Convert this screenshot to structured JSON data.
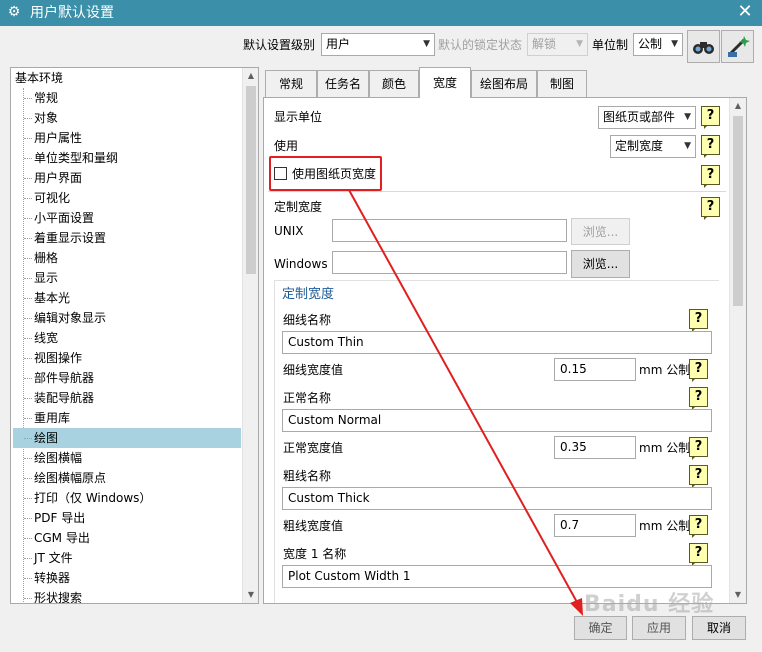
{
  "window": {
    "title": "用户默认设置",
    "close_glyph": "✕",
    "gear_glyph": "⚙"
  },
  "toolbar": {
    "level_label": "默认设置级别",
    "level_value": "用户",
    "lock_label": "默认的锁定状态",
    "lock_value": "解锁",
    "unit_label": "单位制",
    "unit_value": "公制"
  },
  "tree": {
    "root": "基本环境",
    "items": [
      "常规",
      "对象",
      "用户属性",
      "单位类型和量纲",
      "用户界面",
      "可视化",
      "小平面设置",
      "着重显示设置",
      "栅格",
      "显示",
      "基本光",
      "编辑对象显示",
      "线宽",
      "视图操作",
      "部件导航器",
      "装配导航器",
      "重用库",
      "绘图",
      "绘图横幅",
      "绘图横幅原点",
      "打印（仅 Windows）",
      "PDF 导出",
      "CGM 导出",
      "JT 文件",
      "转换器",
      "形状搜索"
    ],
    "selected": "绘图"
  },
  "tabs": [
    "常规",
    "任务名",
    "颜色",
    "宽度",
    "绘图布局",
    "制图"
  ],
  "active_tab": "宽度",
  "form": {
    "display_unit_label": "显示单位",
    "display_unit_value": "图纸页或部件",
    "use_label": "使用",
    "use_value": "定制宽度",
    "use_sheet_width_label": "使用图纸页宽度",
    "use_sheet_width_checked": false,
    "custom_width_label": "定制宽度",
    "unix_label": "UNIX",
    "unix_value": "",
    "windows_label": "Windows",
    "windows_value": "",
    "browse_label": "浏览...",
    "group_title": "定制宽度",
    "thin_name_label": "细线名称",
    "thin_name_value": "Custom Thin",
    "thin_width_label": "细线宽度值",
    "thin_width_value": "0.15",
    "normal_name_label": "正常名称",
    "normal_name_value": "Custom Normal",
    "normal_width_label": "正常宽度值",
    "normal_width_value": "0.35",
    "thick_name_label": "粗线名称",
    "thick_name_value": "Custom Thick",
    "thick_width_label": "粗线宽度值",
    "thick_width_value": "0.7",
    "width1_name_label": "宽度 1 名称",
    "width1_name_value": "Plot Custom Width 1",
    "unit_suffix": "mm 公制",
    "help_glyph": "?"
  },
  "buttons": {
    "ok": "确定",
    "apply": "应用",
    "cancel": "取消"
  },
  "watermark": "Baidu 经验",
  "colors": {
    "title_bar": "#3b8fa8",
    "selection": "#a8d2e0",
    "highlight": "#e02020",
    "group_title": "#1e5c99",
    "help_bg": "#ffffb0"
  }
}
